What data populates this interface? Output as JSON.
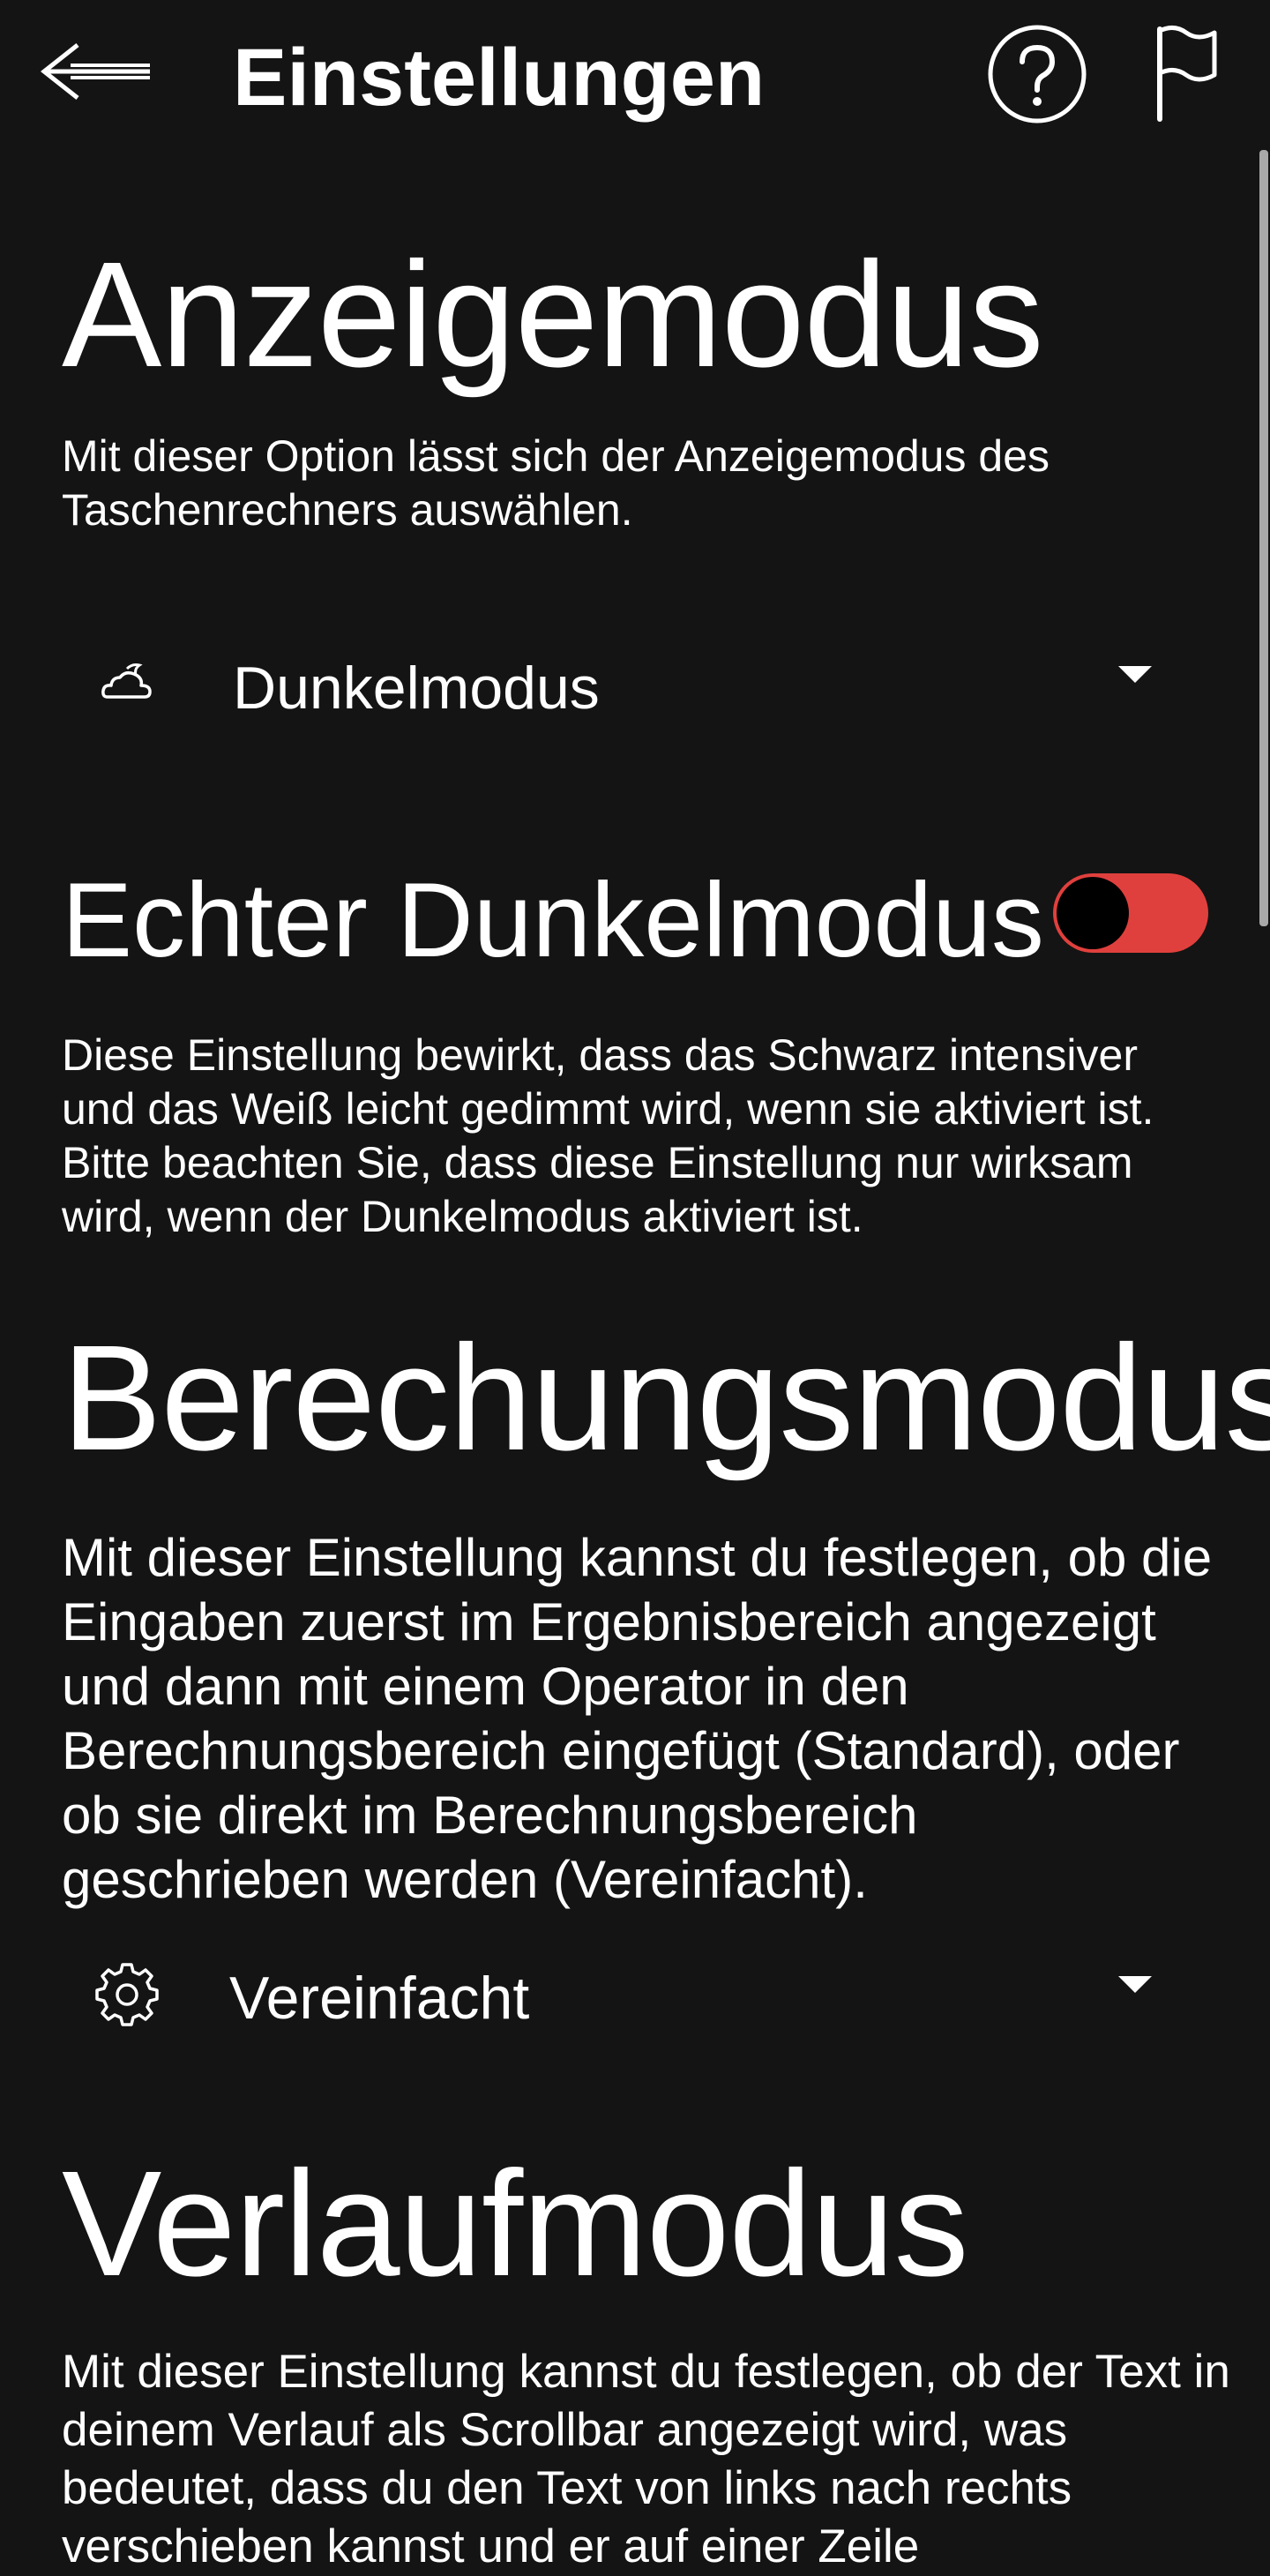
{
  "header": {
    "title": "Einstellungen",
    "back_icon": "arrow-left-icon",
    "help_icon": "help-circle-icon",
    "flag_icon": "flag-icon"
  },
  "display_mode": {
    "title": "Anzeigemodus",
    "description": "Mit dieser Option lässt sich der Anzeigemodus des Taschenrechners auswählen.",
    "selected": "Dunkelmodus",
    "icon": "cloud-moon-icon"
  },
  "true_dark_mode": {
    "title": "Echter Dunkelmodus",
    "description": "Diese Einstellung bewirkt, dass das Schwarz intensiver und das Weiß leicht gedimmt wird, wenn sie aktiviert ist. Bitte beachten Sie, dass diese Einstellung nur wirksam wird, wenn der Dunkelmodus aktiviert ist.",
    "toggle_on_color": "#e0403d"
  },
  "calculation_mode": {
    "title": "Berechungsmodus",
    "description": "Mit dieser Einstellung kannst du festlegen, ob die Eingaben zuerst im Ergebnisbereich angezeigt und dann mit einem Operator in den Berechnungsbereich eingefügt (Standard), oder ob sie direkt im Berechnungsbereich geschrieben werden (Vereinfacht).",
    "selected": "Vereinfacht",
    "icon": "gear-icon"
  },
  "history_mode": {
    "title": "Verlaufmodus",
    "description": "Mit dieser Einstellung kannst du festlegen, ob der Text in deinem Verlauf als Scrollbar angezeigt wird, was bedeutet, dass du den Text von links nach rechts verschieben kannst und er auf einer Zeile"
  },
  "colors": {
    "background": "#141414",
    "text": "#ffffff",
    "accent": "#e0403d"
  }
}
